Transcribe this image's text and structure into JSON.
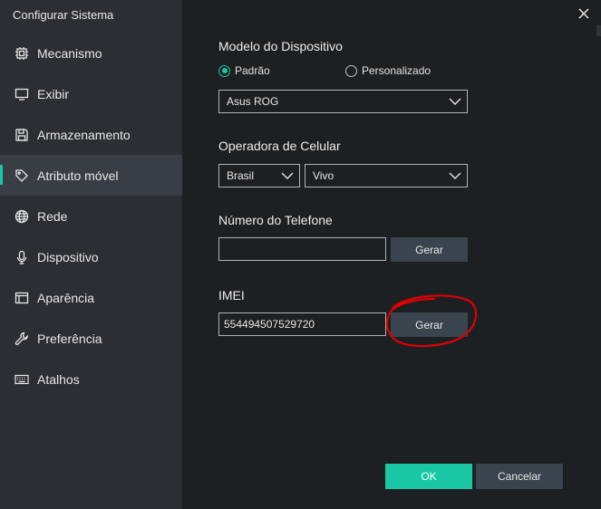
{
  "window": {
    "title": "Configurar Sistema"
  },
  "sidebar": {
    "items": [
      {
        "label": "Mecanismo",
        "icon": "cpu-icon"
      },
      {
        "label": "Exibir",
        "icon": "monitor-icon"
      },
      {
        "label": "Armazenamento",
        "icon": "floppy-disk-icon"
      },
      {
        "label": "Atributo móvel",
        "icon": "tag-icon",
        "active": true
      },
      {
        "label": "Rede",
        "icon": "globe-icon"
      },
      {
        "label": "Dispositivo",
        "icon": "microphone-icon"
      },
      {
        "label": "Aparência",
        "icon": "window-icon"
      },
      {
        "label": "Preferência",
        "icon": "wrench-icon"
      },
      {
        "label": "Atalhos",
        "icon": "keyboard-icon"
      }
    ]
  },
  "device_model": {
    "label": "Modelo do Dispositivo",
    "option_default": "Padrão",
    "option_custom": "Personalizado",
    "selected_option": "Padrão",
    "model": "Asus ROG"
  },
  "carrier": {
    "label": "Operadora de Celular",
    "country": "Brasil",
    "operator": "Vivo"
  },
  "phone": {
    "label": "Número do Telefone",
    "value": "",
    "generate_label": "Gerar"
  },
  "imei": {
    "label": "IMEI",
    "value": "554494507529720",
    "generate_label": "Gerar"
  },
  "footer": {
    "ok_label": "OK",
    "cancel_label": "Cancelar"
  },
  "colors": {
    "accent": "#19c7a5",
    "annotation": "#e00000"
  }
}
